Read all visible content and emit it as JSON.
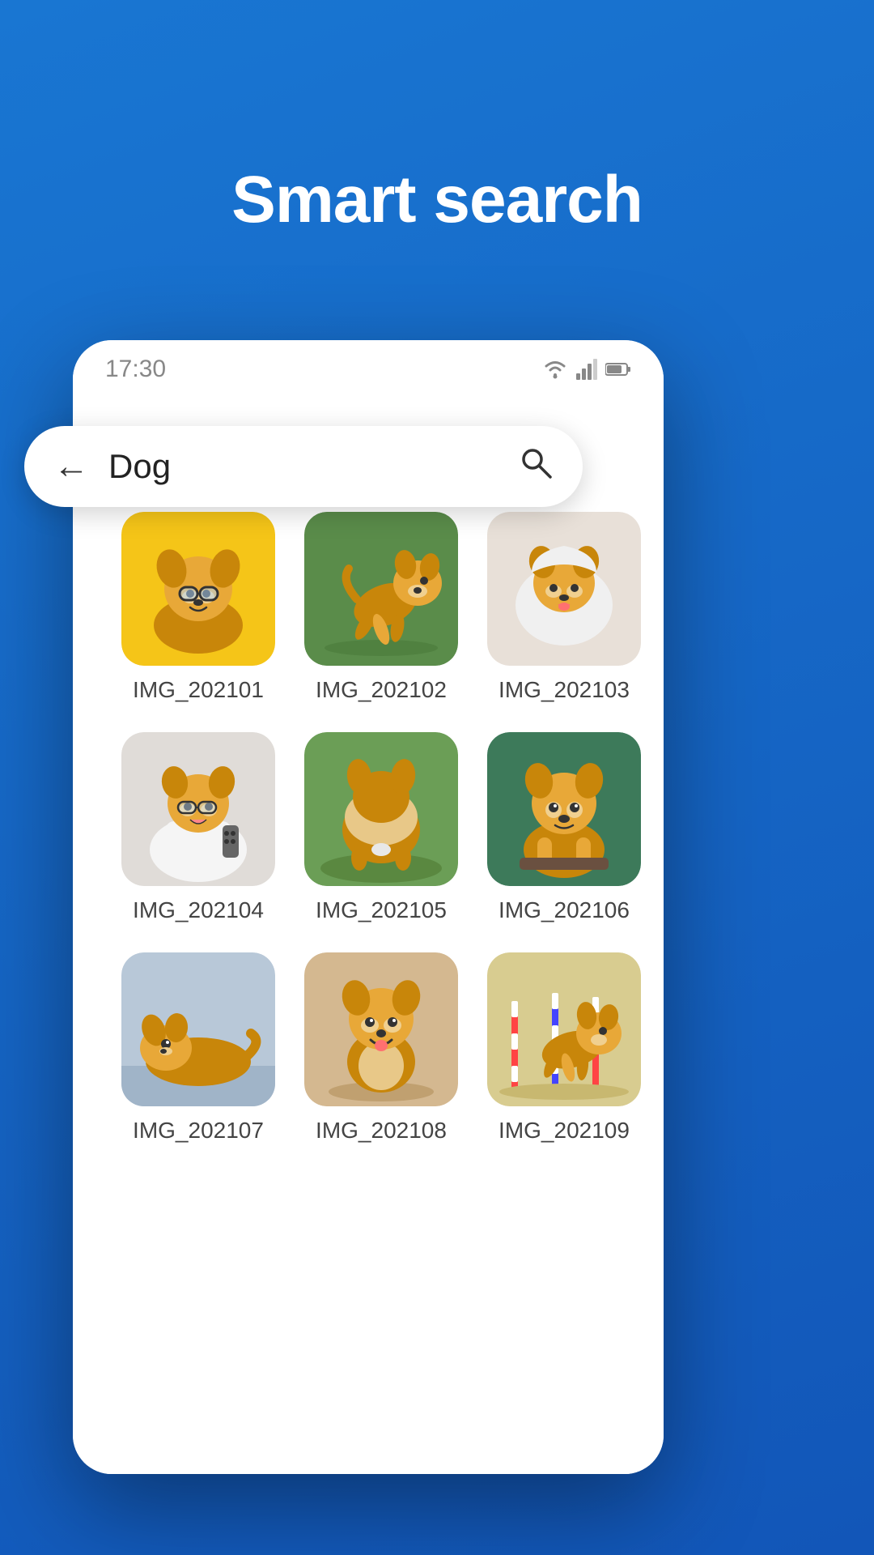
{
  "page": {
    "title": "Smart search",
    "background_color": "#1565C0"
  },
  "status_bar": {
    "time": "17:30",
    "wifi_icon": "wifi",
    "signal_icon": "signal",
    "battery_icon": "battery"
  },
  "search_bar": {
    "back_icon": "←",
    "query": "Dog",
    "search_icon": "🔍"
  },
  "photos": [
    {
      "id": "img-01",
      "label": "IMG_202101",
      "bg": "#f5c518",
      "dog_color": "#c8860a",
      "scene": "glasses"
    },
    {
      "id": "img-02",
      "label": "IMG_202102",
      "bg": "#5a8c4a",
      "dog_color": "#c8860a",
      "scene": "running"
    },
    {
      "id": "img-03",
      "label": "IMG_202103",
      "bg": "#e8e0d8",
      "dog_color": "#c8860a",
      "scene": "blanket"
    },
    {
      "id": "img-04",
      "label": "IMG_202104",
      "bg": "#e8e0d8",
      "dog_color": "#c8860a",
      "scene": "robe"
    },
    {
      "id": "img-05",
      "label": "IMG_202105",
      "bg": "#6b9e56",
      "dog_color": "#c8860a",
      "scene": "grass"
    },
    {
      "id": "img-06",
      "label": "IMG_202106",
      "bg": "#3d7a5a",
      "dog_color": "#c8860a",
      "scene": "looking"
    },
    {
      "id": "img-07",
      "label": "IMG_202107",
      "bg": "#c8d4e0",
      "dog_color": "#c8860a",
      "scene": "lying"
    },
    {
      "id": "img-08",
      "label": "IMG_202108",
      "bg": "#c4a882",
      "dog_color": "#c8860a",
      "scene": "sitting"
    },
    {
      "id": "img-09",
      "label": "IMG_202109",
      "bg": "#d4c898",
      "dog_color": "#c8860a",
      "scene": "agility"
    }
  ]
}
